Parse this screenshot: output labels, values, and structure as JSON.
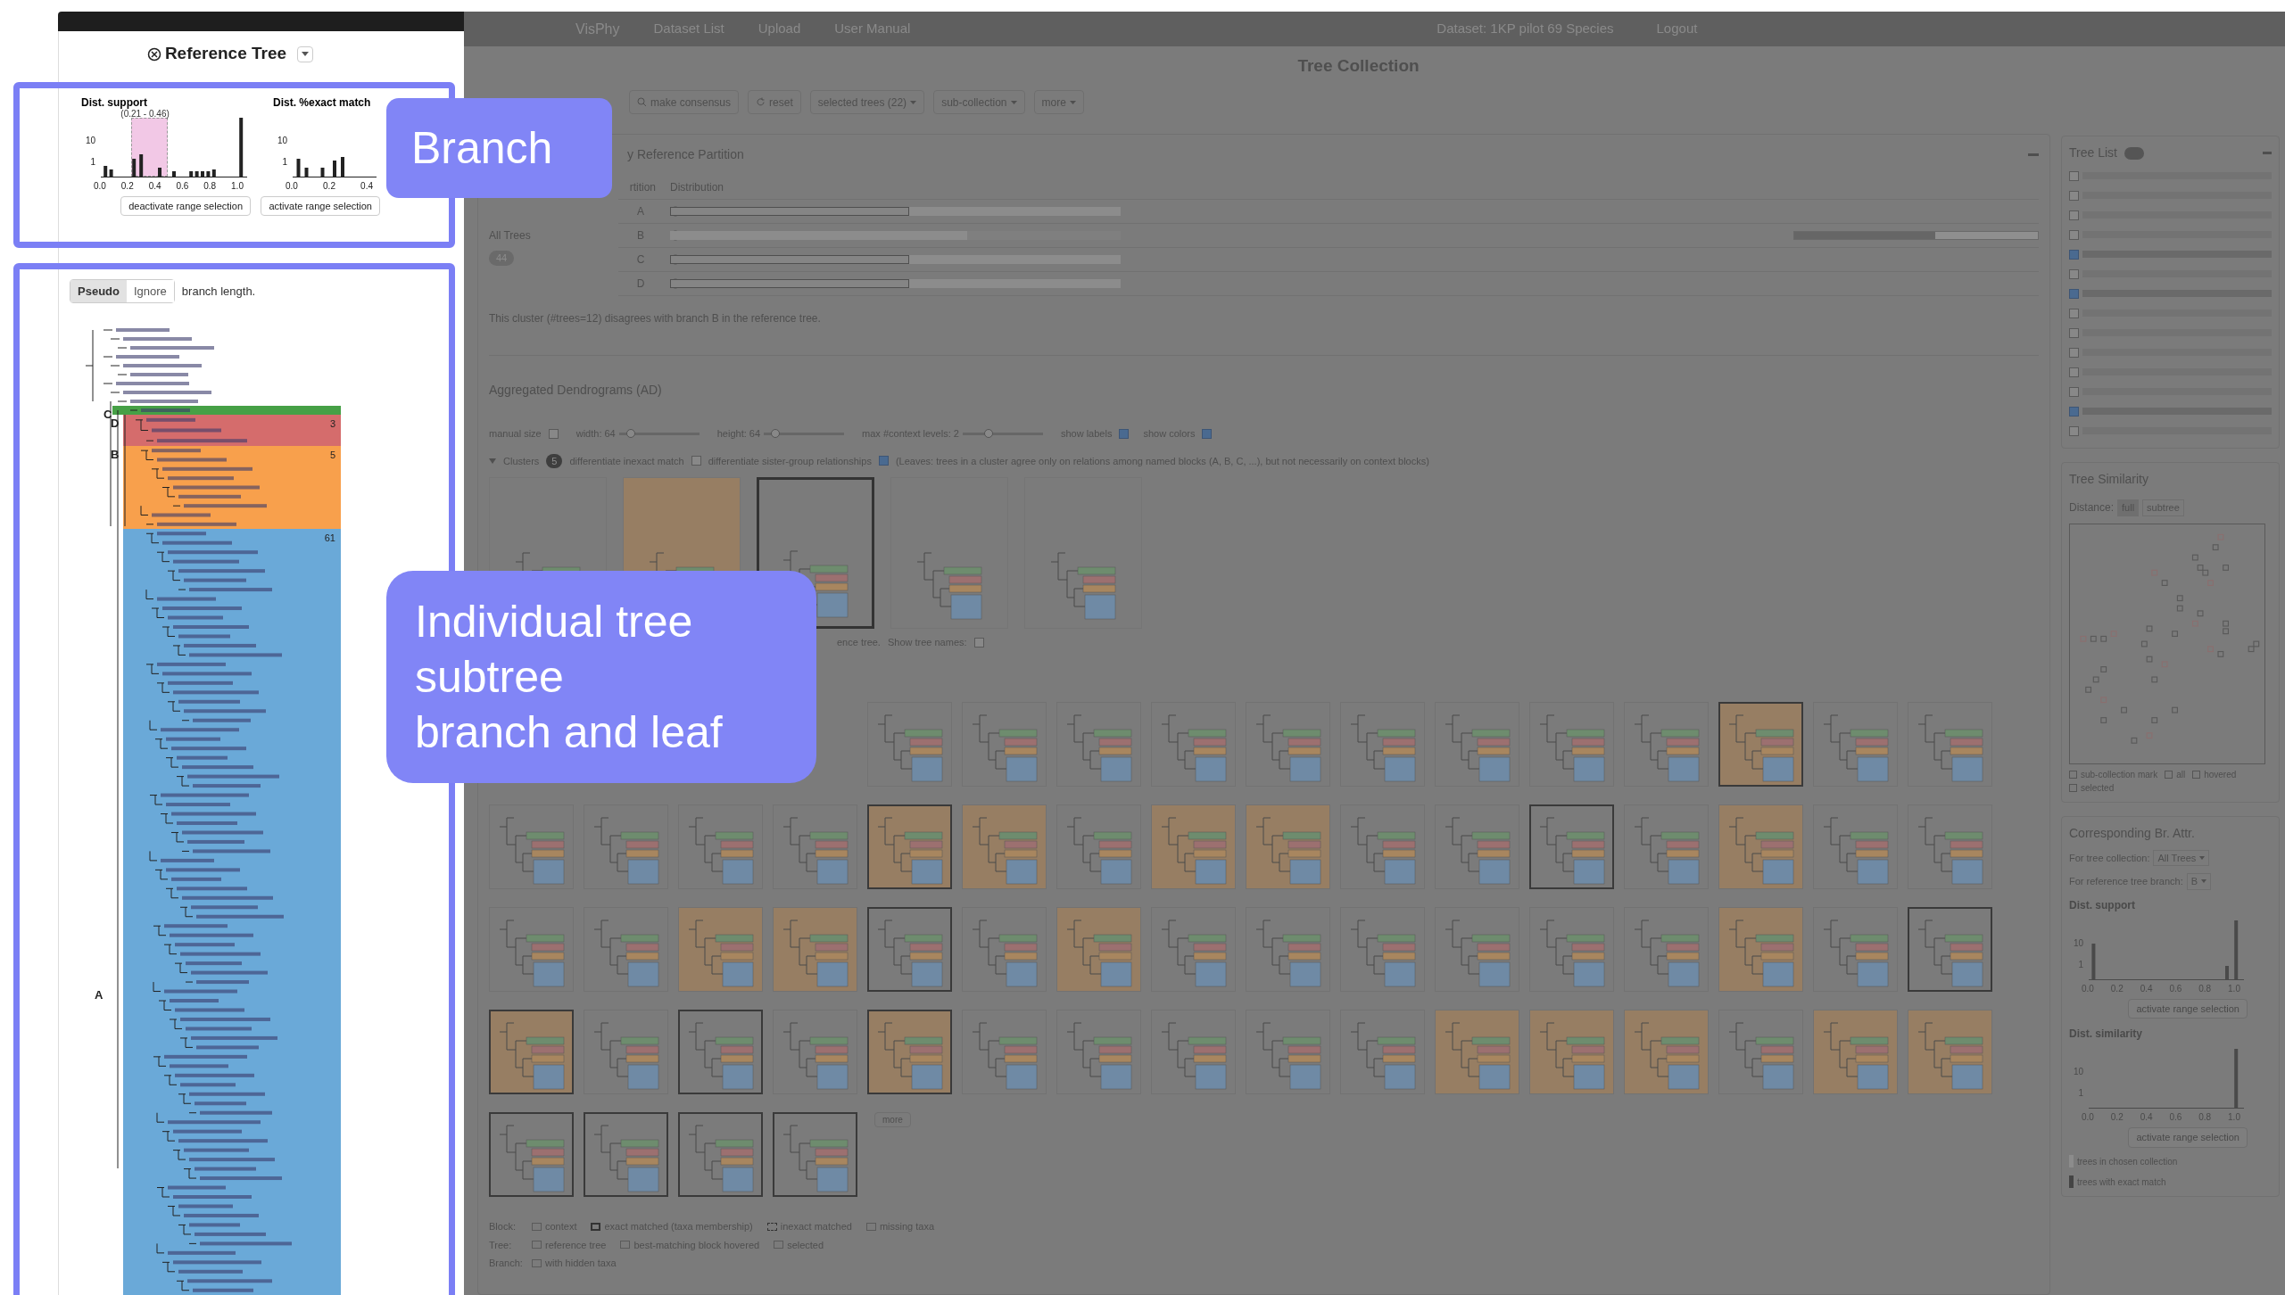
{
  "nav": {
    "brand": "VisPhy",
    "links": [
      "Dataset List",
      "Upload",
      "User Manual"
    ],
    "dataset": "Dataset: 1KP pilot 69 Species",
    "logout": "Logout"
  },
  "reference_tree": {
    "title": "Reference Tree",
    "histograms": [
      {
        "title": "Dist. support",
        "range_label": "(0.21 - 0.46)",
        "range_active": true,
        "yticks": [
          "10",
          "1"
        ],
        "xticks": [
          "0.0",
          "0.2",
          "0.4",
          "0.6",
          "0.8",
          "1.0"
        ],
        "button": "deactivate range selection"
      },
      {
        "title": "Dist. %exact match",
        "yticks": [
          "10",
          "1"
        ],
        "xticks": [
          "0.0",
          "0.2",
          "0.4"
        ],
        "button": "activate range selection"
      }
    ],
    "branch_modes": [
      {
        "label": "Pseudo",
        "selected": true
      },
      {
        "label": "Ignore",
        "selected": false
      }
    ],
    "branch_label": "branch length.",
    "blocks": [
      {
        "name": "C",
        "color": "#46a046"
      },
      {
        "name": "D",
        "count": "3",
        "color": "#d56c6c"
      },
      {
        "name": "B",
        "count": "5",
        "color": "#f8a04c"
      },
      {
        "name": "A",
        "count": "61",
        "color": "#6aa9d8"
      }
    ]
  },
  "page_title": "Tree Collection",
  "toolbar": [
    {
      "label": "make consensus",
      "kind": "consensus"
    },
    {
      "label": "reset",
      "kind": "reset"
    },
    {
      "label": "selected trees (22)",
      "kind": "menu"
    },
    {
      "label": "sub-collection",
      "kind": "menu"
    },
    {
      "label": "more",
      "kind": "menu"
    }
  ],
  "partition": {
    "heading": "y Reference Partition",
    "col_partition": "rtition",
    "col_distribution": "Distribution",
    "group": "All Trees",
    "group_count": "44",
    "rows": [
      {
        "label": "A",
        "level": 0.53,
        "outlined": true
      },
      {
        "label": "B",
        "level": 0.66,
        "outlined": false,
        "side_bar": {
          "level": 0.58
        }
      },
      {
        "label": "C",
        "level": 0.53,
        "outlined": true
      },
      {
        "label": "D",
        "level": 0.53,
        "outlined": true
      }
    ],
    "note": "This cluster (#trees=12) disagrees with branch B in the reference tree."
  },
  "ad": {
    "heading": "Aggregated Dendrograms (AD)",
    "manual_size": {
      "label": "manual size",
      "checked": false
    },
    "width": {
      "label": "width: 64",
      "level": 0.1
    },
    "height": {
      "label": "height: 64",
      "level": 0.1
    },
    "context": {
      "label": "max #context levels: 2",
      "level": 0.3
    },
    "show_labels": {
      "label": "show labels",
      "checked": true
    },
    "show_colors": {
      "label": "show colors",
      "checked": true
    },
    "clusters_label": "Clusters",
    "clusters_count": "5",
    "inexact": {
      "label": "differentiate inexact match",
      "checked": false
    },
    "sister": {
      "label": "differentiate sister-group relationships",
      "checked": true
    },
    "sister_note": "(Leaves: trees in a cluster agree only on relations among named blocks (A, B, C, ...), but not necessarily on context blocks)",
    "clusters": [
      {
        "selected": false,
        "boxed": false
      },
      {
        "selected": true,
        "boxed": false
      },
      {
        "selected": false,
        "boxed": true
      },
      {
        "selected": false,
        "boxed": false
      },
      {
        "selected": false,
        "boxed": false
      }
    ],
    "cut_text": "ence tree.",
    "show_names": {
      "label": "Show tree names:",
      "checked": false
    },
    "grid": [
      [
        {
          "selected": false,
          "boxed": false
        },
        {
          "selected": false,
          "boxed": false
        },
        {
          "selected": false,
          "boxed": false
        },
        {
          "selected": false,
          "boxed": false
        },
        {
          "selected": false,
          "boxed": false
        },
        {
          "selected": false,
          "boxed": false
        },
        {
          "selected": false,
          "boxed": false
        },
        {
          "selected": false,
          "boxed": false
        },
        {
          "selected": false,
          "boxed": false
        },
        {
          "selected": true,
          "boxed": true
        },
        {
          "selected": false,
          "boxed": false
        },
        {
          "selected": false,
          "boxed": false
        }
      ],
      [
        {
          "selected": false,
          "boxed": false
        },
        {
          "selected": false,
          "boxed": false
        },
        {
          "selected": false,
          "boxed": false
        },
        {
          "selected": false,
          "boxed": false
        },
        {
          "selected": true,
          "boxed": true
        },
        {
          "selected": true,
          "boxed": false
        },
        {
          "selected": false,
          "boxed": false
        },
        {
          "selected": true,
          "boxed": false
        },
        {
          "selected": true,
          "boxed": false
        },
        {
          "selected": false,
          "boxed": false
        },
        {
          "selected": false,
          "boxed": false
        },
        {
          "selected": false,
          "boxed": true
        },
        {
          "selected": false,
          "boxed": false
        },
        {
          "selected": true,
          "boxed": false
        },
        {
          "selected": false,
          "boxed": false
        },
        {
          "selected": false,
          "boxed": false
        }
      ],
      [
        {
          "selected": false,
          "boxed": false
        },
        {
          "selected": false,
          "boxed": false
        },
        {
          "selected": true,
          "boxed": false
        },
        {
          "selected": true,
          "boxed": false
        },
        {
          "selected": false,
          "boxed": true
        },
        {
          "selected": false,
          "boxed": false
        },
        {
          "selected": true,
          "boxed": false
        },
        {
          "selected": false,
          "boxed": false
        },
        {
          "selected": false,
          "boxed": false
        },
        {
          "selected": false,
          "boxed": false
        },
        {
          "selected": false,
          "boxed": false
        },
        {
          "selected": false,
          "boxed": false
        },
        {
          "selected": false,
          "boxed": false
        },
        {
          "selected": true,
          "boxed": false
        },
        {
          "selected": false,
          "boxed": false
        },
        {
          "selected": false,
          "boxed": true
        }
      ],
      [
        {
          "selected": true,
          "boxed": true
        },
        {
          "selected": false,
          "boxed": false
        },
        {
          "selected": false,
          "boxed": true
        },
        {
          "selected": false,
          "boxed": false
        },
        {
          "selected": true,
          "boxed": true
        },
        {
          "selected": false,
          "boxed": false
        },
        {
          "selected": false,
          "boxed": false
        },
        {
          "selected": false,
          "boxed": false
        },
        {
          "selected": false,
          "boxed": false
        },
        {
          "selected": false,
          "boxed": false
        },
        {
          "selected": true,
          "boxed": false
        },
        {
          "selected": true,
          "boxed": false
        },
        {
          "selected": true,
          "boxed": false
        },
        {
          "selected": false,
          "boxed": false
        },
        {
          "selected": true,
          "boxed": false
        },
        {
          "selected": true,
          "boxed": false
        }
      ],
      [
        {
          "selected": false,
          "boxed": true
        },
        {
          "selected": false,
          "boxed": true
        },
        {
          "selected": false,
          "boxed": true
        },
        {
          "selected": false,
          "boxed": true
        }
      ]
    ],
    "more": "more",
    "legend": [
      {
        "title": "Block:",
        "items": [
          "context",
          "exact matched (taxa membership)",
          "inexact matched",
          "missing taxa"
        ]
      },
      {
        "title": "Tree:",
        "items": [
          "reference tree",
          "best-matching block hovered",
          "selected"
        ]
      },
      {
        "title": "Branch:",
        "items": [
          "with hidden taxa"
        ]
      }
    ]
  },
  "tree_list": {
    "title": "Tree List",
    "items": [
      {
        "checked": false
      },
      {
        "checked": false
      },
      {
        "checked": false
      },
      {
        "checked": false
      },
      {
        "checked": true
      },
      {
        "checked": false
      },
      {
        "checked": true
      },
      {
        "checked": false
      },
      {
        "checked": false
      },
      {
        "checked": false
      },
      {
        "checked": false
      },
      {
        "checked": false
      },
      {
        "checked": true
      },
      {
        "checked": false
      }
    ]
  },
  "similarity": {
    "title": "Tree Similarity",
    "distance_label": "Distance:",
    "modes": [
      {
        "label": "full",
        "selected": true
      },
      {
        "label": "subtree",
        "selected": false
      }
    ],
    "legend": [
      "sub-collection mark",
      "all",
      "hovered",
      "selected"
    ]
  },
  "branch_attr": {
    "title": "Corresponding Br. Attr.",
    "collection_label": "For tree collection:",
    "collection_value": "All Trees",
    "branch_label": "For reference tree branch:",
    "branch_value": "B",
    "histograms": [
      {
        "title": "Dist. support",
        "yticks": [
          "10",
          "1"
        ],
        "xticks": [
          "0.0",
          "0.2",
          "0.4",
          "0.6",
          "0.8",
          "1.0"
        ],
        "button": "activate range selection"
      },
      {
        "title": "Dist. similarity",
        "yticks": [
          "10",
          "1"
        ],
        "xticks": [
          "0.0",
          "0.2",
          "0.4",
          "0.6",
          "0.8",
          "1.0"
        ],
        "button": "activate range selection"
      }
    ],
    "legend": [
      "trees in chosen collection",
      "trees with exact match"
    ]
  },
  "callouts": [
    {
      "lines": [
        "Branch"
      ]
    },
    {
      "lines": [
        "Individual tree",
        "subtree",
        "branch and leaf"
      ]
    }
  ]
}
